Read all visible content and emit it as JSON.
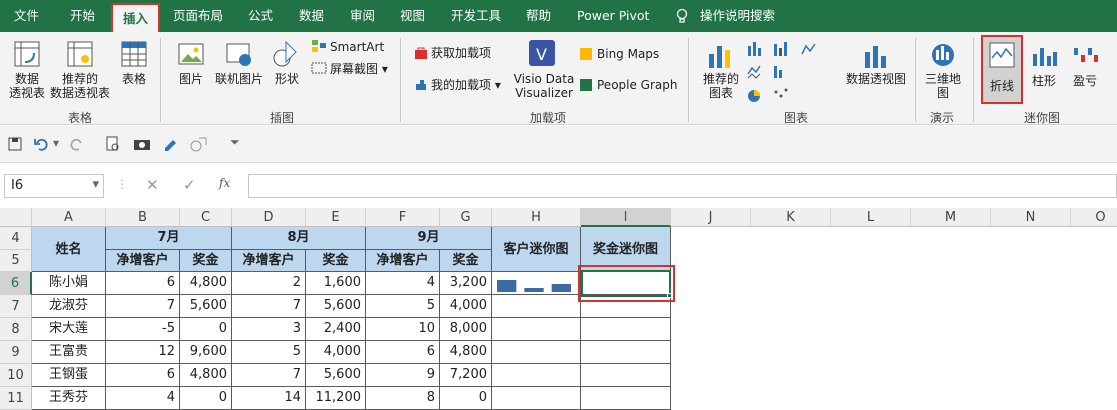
{
  "tabs": [
    "文件",
    "开始",
    "插入",
    "页面布局",
    "公式",
    "数据",
    "审阅",
    "视图",
    "开发工具",
    "帮助",
    "Power Pivot",
    "操作说明搜索"
  ],
  "ribbon": {
    "tables": {
      "pivot": "数据\n透视表",
      "recommended_pivot": "推荐的\n数据透视表",
      "table": "表格",
      "label": "表格"
    },
    "illustrations": {
      "picture": "图片",
      "online_picture": "联机图片",
      "shapes": "形状",
      "smartart": "SmartArt",
      "screenshot": "屏幕截图",
      "label": "插图"
    },
    "addins": {
      "get": "获取加载项",
      "mine": "我的加载项",
      "visio": "Visio Data\nVisualizer",
      "bing": "Bing Maps",
      "people": "People Graph",
      "label": "加载项"
    },
    "charts": {
      "recommended": "推荐的\n图表",
      "pivot_chart": "数据透视图",
      "label": "图表"
    },
    "tours": {
      "map3d": "三维地\n图",
      "label": "演示"
    },
    "sparklines": {
      "line": "折线",
      "column": "柱形",
      "winloss": "盈亏",
      "label": "迷你图"
    }
  },
  "formula_bar": {
    "name_box": "I6",
    "fx": "fx",
    "value": ""
  },
  "columns": [
    "A",
    "B",
    "C",
    "D",
    "E",
    "F",
    "G",
    "H",
    "I",
    "J",
    "K",
    "L",
    "M",
    "N",
    "O"
  ],
  "rows": [
    "4",
    "5",
    "6",
    "7",
    "8",
    "9",
    "10",
    "11"
  ],
  "sheet": {
    "name_header": "姓名",
    "months": [
      "7月",
      "8月",
      "9月"
    ],
    "sub_headers": [
      "净增客户",
      "奖金",
      "净增客户",
      "奖金",
      "净增客户",
      "奖金"
    ],
    "spark_customer": "客户迷你图",
    "spark_bonus": "奖金迷你图",
    "data": [
      {
        "name": "陈小娟",
        "v": [
          "6",
          "4,800",
          "2",
          "1,600",
          "4",
          "3,200"
        ]
      },
      {
        "name": "龙淑芬",
        "v": [
          "7",
          "5,600",
          "7",
          "5,600",
          "5",
          "4,000"
        ]
      },
      {
        "name": "宋大莲",
        "v": [
          "-5",
          "0",
          "3",
          "2,400",
          "10",
          "8,000"
        ]
      },
      {
        "name": "王富贵",
        "v": [
          "12",
          "9,600",
          "5",
          "4,000",
          "6",
          "4,800"
        ]
      },
      {
        "name": "王钢蛋",
        "v": [
          "6",
          "4,800",
          "7",
          "5,600",
          "9",
          "7,200"
        ]
      },
      {
        "name": "王秀芬",
        "v": [
          "4",
          "0",
          "14",
          "11,200",
          "8",
          "0"
        ]
      }
    ],
    "h6_sparkline": [
      6,
      2,
      4
    ]
  },
  "colors": {
    "brand": "#217346",
    "header_fill": "#bdd7ee",
    "highlight": "#d9302c",
    "spark": "#3e6aa3"
  }
}
